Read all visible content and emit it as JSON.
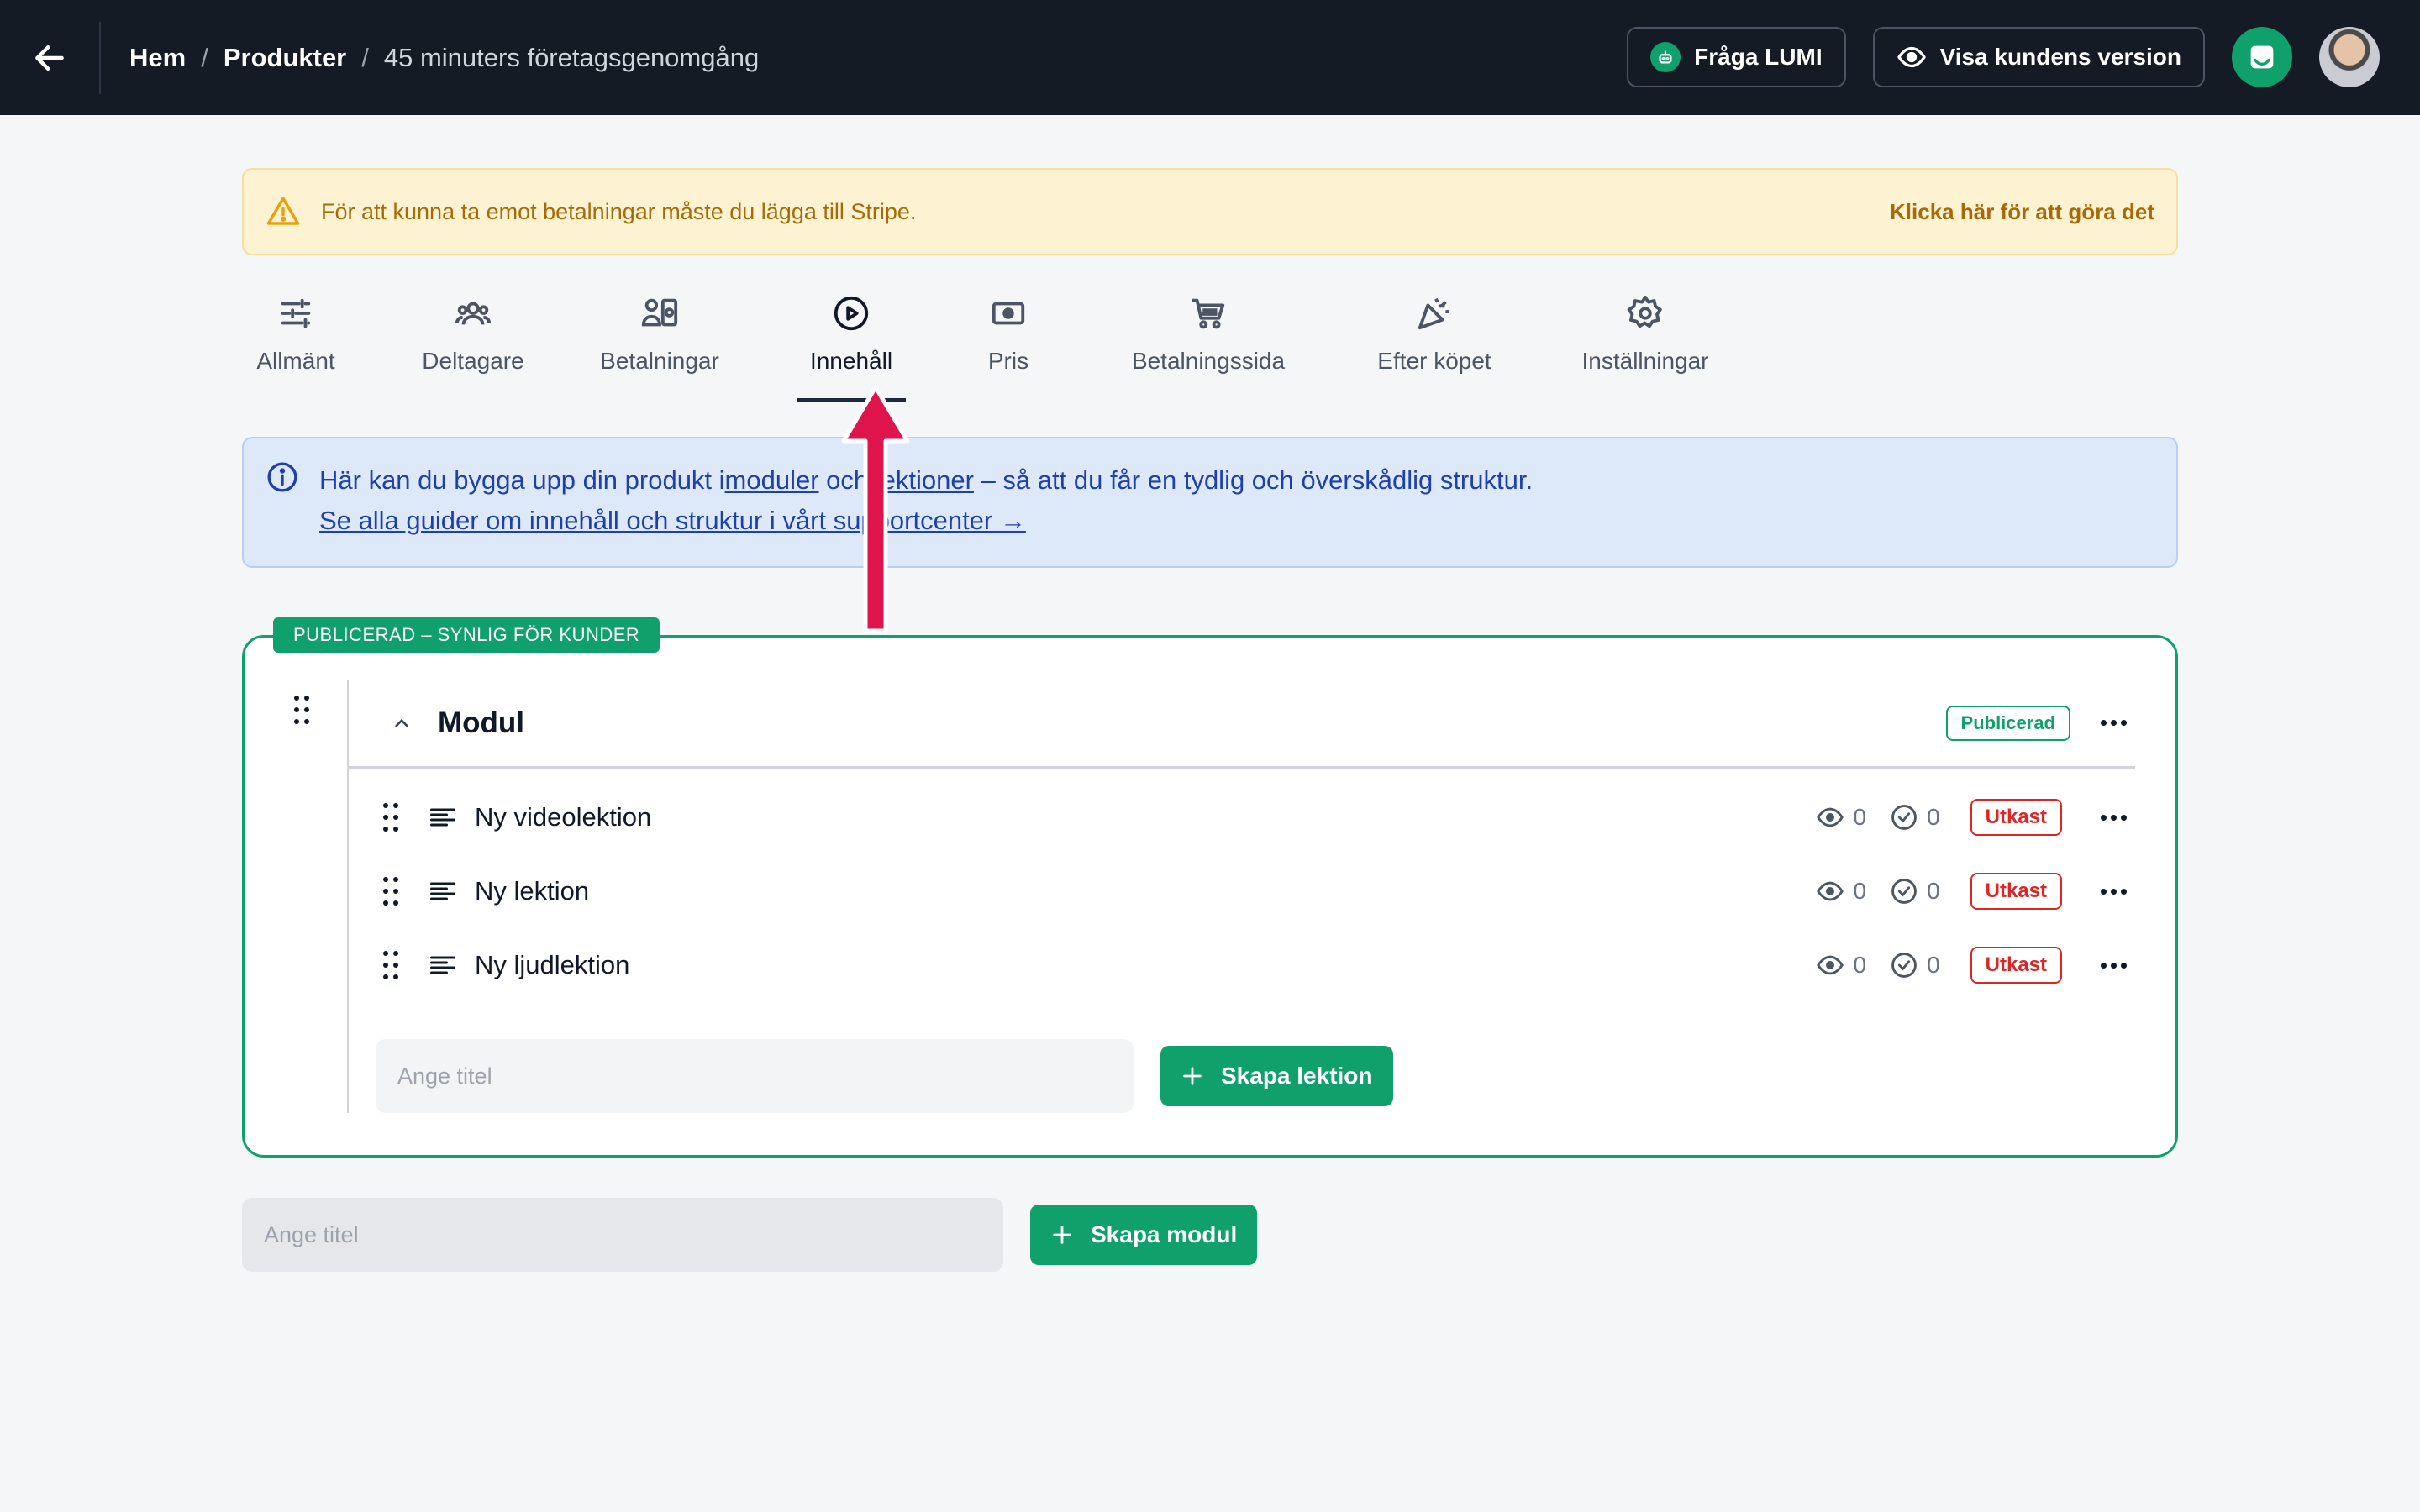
{
  "header": {
    "breadcrumb": {
      "home": "Hem",
      "sep1": "/",
      "products": "Produkter",
      "sep2": "/",
      "current": "45 minuters företagsgenomgång"
    },
    "ask_lumi": "Fråga LUMI",
    "customer_view": "Visa kundens version"
  },
  "alert": {
    "text": "För att kunna ta emot betalningar måste du lägga till Stripe.",
    "link": "Klicka här för att göra det"
  },
  "tabs": [
    {
      "label": "Allmänt",
      "icon": "sliders-icon"
    },
    {
      "label": "Deltagare",
      "icon": "users-icon"
    },
    {
      "label": "Betalningar",
      "icon": "payments-icon"
    },
    {
      "label": "Innehåll",
      "icon": "play-circle-icon",
      "active": true
    },
    {
      "label": "Pris",
      "icon": "money-icon"
    },
    {
      "label": "Betalningssida",
      "icon": "cart-icon"
    },
    {
      "label": "Efter köpet",
      "icon": "party-icon"
    },
    {
      "label": "Inställningar",
      "icon": "gear-icon"
    }
  ],
  "info": {
    "line1_pre": "Här kan du bygga upp din produkt i",
    "line1_link1": "moduler",
    "line1_mid": " och ",
    "line1_link2": "lektioner",
    "line1_post": " – så att du får en tydlig och överskådlig struktur.",
    "line2": "Se alla guider om innehåll och struktur i vårt supportcenter →"
  },
  "module": {
    "tag": "PUBLICERAD – SYNLIG FÖR KUNDER",
    "title": "Modul",
    "status": "Publicerad",
    "lessons": [
      {
        "name": "Ny videolektion",
        "views": "0",
        "completed": "0",
        "status": "Utkast"
      },
      {
        "name": "Ny lektion",
        "views": "0",
        "completed": "0",
        "status": "Utkast"
      },
      {
        "name": "Ny ljudlektion",
        "views": "0",
        "completed": "0",
        "status": "Utkast"
      }
    ],
    "new_lesson_placeholder": "Ange titel",
    "create_lesson": "Skapa lektion"
  },
  "new_module": {
    "placeholder": "Ange titel",
    "create_module": "Skapa modul"
  },
  "colors": {
    "accent": "#10a06b",
    "draft": "#dc2626",
    "header": "#141b25",
    "arrow": "#e0144c"
  }
}
